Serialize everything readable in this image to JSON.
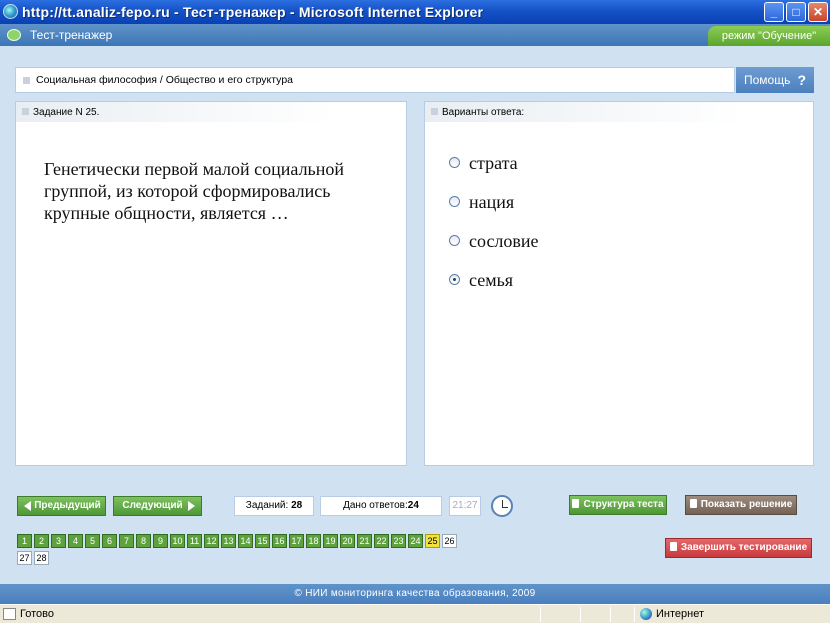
{
  "window": {
    "title": "http://tt.analiz-fepo.ru - Тест-тренажер - Microsoft Internet Explorer",
    "minimize": "_",
    "maximize": "□",
    "close": "✕"
  },
  "app": {
    "title": "Тест-тренажер",
    "mode": "режим \"Обучение\""
  },
  "breadcrumb": "Социальная философия / Общество и его структура",
  "help_label": "Помощь",
  "help_icon": "?",
  "task": {
    "header": "Задание N 25.",
    "question": "Генетически первой малой социальной группой, из которой сформировались крупные общности, является …"
  },
  "answers": {
    "header": "Варианты ответа:",
    "options": [
      {
        "label": "страта",
        "selected": false
      },
      {
        "label": "нация",
        "selected": false
      },
      {
        "label": "сословие",
        "selected": false
      },
      {
        "label": "семья",
        "selected": true
      }
    ]
  },
  "controls": {
    "prev": "Предыдущий",
    "next": "Следующий",
    "tasks_label": "Заданий:",
    "tasks_value": "28",
    "answered_label": "Дано ответов:",
    "answered_value": "24",
    "timer": "21:27",
    "structure": "Структура теста",
    "solution": "Показать решение",
    "finish": "Завершить тестирование"
  },
  "task_numbers": [
    {
      "n": "1",
      "state": "done"
    },
    {
      "n": "2",
      "state": "done"
    },
    {
      "n": "3",
      "state": "done"
    },
    {
      "n": "4",
      "state": "done"
    },
    {
      "n": "5",
      "state": "done"
    },
    {
      "n": "6",
      "state": "done"
    },
    {
      "n": "7",
      "state": "done"
    },
    {
      "n": "8",
      "state": "done"
    },
    {
      "n": "9",
      "state": "done"
    },
    {
      "n": "10",
      "state": "done"
    },
    {
      "n": "11",
      "state": "done"
    },
    {
      "n": "12",
      "state": "done"
    },
    {
      "n": "13",
      "state": "done"
    },
    {
      "n": "14",
      "state": "done"
    },
    {
      "n": "15",
      "state": "done"
    },
    {
      "n": "16",
      "state": "done"
    },
    {
      "n": "17",
      "state": "done"
    },
    {
      "n": "18",
      "state": "done"
    },
    {
      "n": "19",
      "state": "done"
    },
    {
      "n": "20",
      "state": "done"
    },
    {
      "n": "21",
      "state": "done"
    },
    {
      "n": "22",
      "state": "done"
    },
    {
      "n": "23",
      "state": "done"
    },
    {
      "n": "24",
      "state": "done"
    },
    {
      "n": "25",
      "state": "current"
    },
    {
      "n": "26",
      "state": "todo"
    },
    {
      "n": "27",
      "state": "todo"
    },
    {
      "n": "28",
      "state": "todo"
    }
  ],
  "footer": "© НИИ мониторинга качества образования, 2009",
  "statusbar": {
    "status": "Готово",
    "zone": "Интернет"
  }
}
